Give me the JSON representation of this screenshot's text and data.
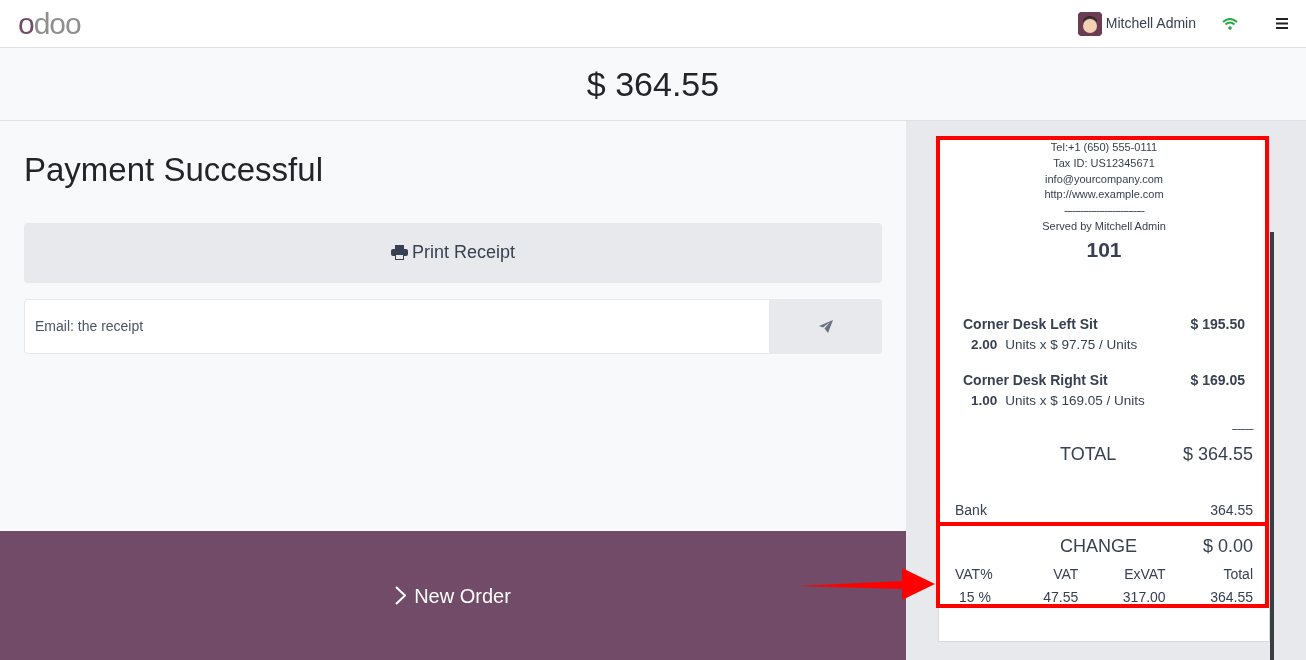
{
  "header": {
    "logo": "odoo",
    "user": "Mitchell Admin"
  },
  "amount": "$ 364.55",
  "payment": {
    "title": "Payment Successful",
    "print_button": "Print Receipt",
    "email": {
      "placeholder": "Email: the receipt"
    }
  },
  "new_order_button": "New Order",
  "receipt": {
    "header_lines": [
      "Tel:+1 (650) 555-0111",
      "Tax ID: US12345671",
      "info@yourcompany.com",
      "http://www.example.com",
      "------------------------------",
      "Served by Mitchell Admin"
    ],
    "order_number": "101",
    "lines": [
      {
        "product": "Corner Desk Left Sit",
        "price": "$ 195.50",
        "quantity": "2.00",
        "unit_detail": "Units x $ 97.75 / Units"
      },
      {
        "product": "Corner Desk Right Sit",
        "price": "$ 169.05",
        "quantity": "1.00",
        "unit_detail": "Units x $ 169.05 / Units"
      }
    ],
    "total_separator": "--------",
    "total_label": "TOTAL",
    "total_value": "$ 364.55",
    "payment_method": "Bank",
    "payment_amount": "364.55",
    "change_label": "CHANGE",
    "change_value": "$ 0.00",
    "tax_columns": [
      "VAT%",
      "VAT",
      "ExVAT",
      "Total"
    ],
    "tax_row": [
      "15 %",
      "47.55",
      "317.00",
      "364.55"
    ]
  }
}
